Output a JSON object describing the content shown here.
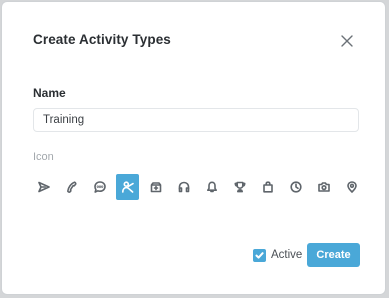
{
  "dialog": {
    "title": "Create Activity Types",
    "close_icon": "close-icon"
  },
  "name_field": {
    "label": "Name",
    "value": "Training"
  },
  "icon_picker": {
    "label": "Icon",
    "selected": "training-icon",
    "icons": [
      "send-icon",
      "phone-icon",
      "chat-icon",
      "training-icon",
      "inbox-icon",
      "headphones-icon",
      "bell-icon",
      "trophy-icon",
      "shopping-bag-icon",
      "clock-icon",
      "camera-icon",
      "location-pin-icon"
    ]
  },
  "active": {
    "label": "Active",
    "checked": true
  },
  "actions": {
    "create_label": "Create"
  },
  "colors": {
    "accent": "#4aa8d8",
    "title_text": "#2b2f33",
    "muted_text": "#a3a8ad"
  }
}
